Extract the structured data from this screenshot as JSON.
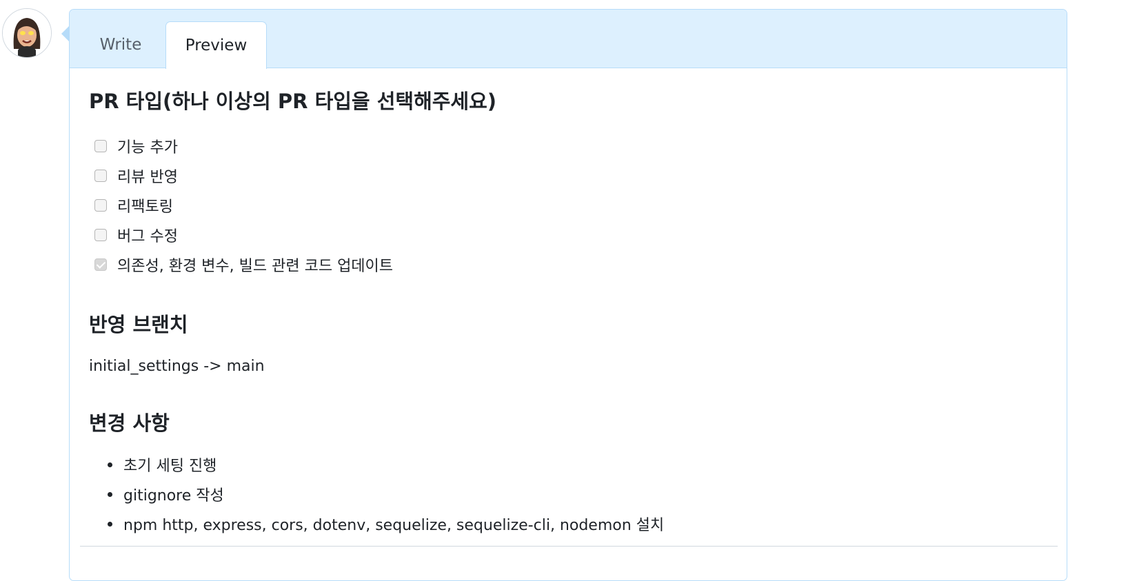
{
  "tabs": {
    "write_label": "Write",
    "preview_label": "Preview",
    "active": "Preview"
  },
  "pr_type": {
    "heading": "PR 타입(하나 이상의 PR 타입을 선택해주세요)",
    "items": [
      {
        "label": "기능 추가",
        "checked": false
      },
      {
        "label": "리뷰 반영",
        "checked": false
      },
      {
        "label": "리팩토링",
        "checked": false
      },
      {
        "label": "버그 수정",
        "checked": false
      },
      {
        "label": "의존성, 환경 변수, 빌드 관련 코드 업데이트",
        "checked": true
      }
    ]
  },
  "branch": {
    "heading": "반영 브랜치",
    "text": "initial_settings -> main"
  },
  "changes": {
    "heading": "변경 사항",
    "items": [
      "초기 세팅 진행",
      "gitignore 작성",
      "npm http, express, cors, dotenv, sequelize, sequelize-cli, nodemon 설치"
    ]
  },
  "colors": {
    "tab_header_bg": "#ddf0fe",
    "border": "#b6dcf9",
    "text": "#1f2328",
    "muted_text": "#57606a"
  }
}
